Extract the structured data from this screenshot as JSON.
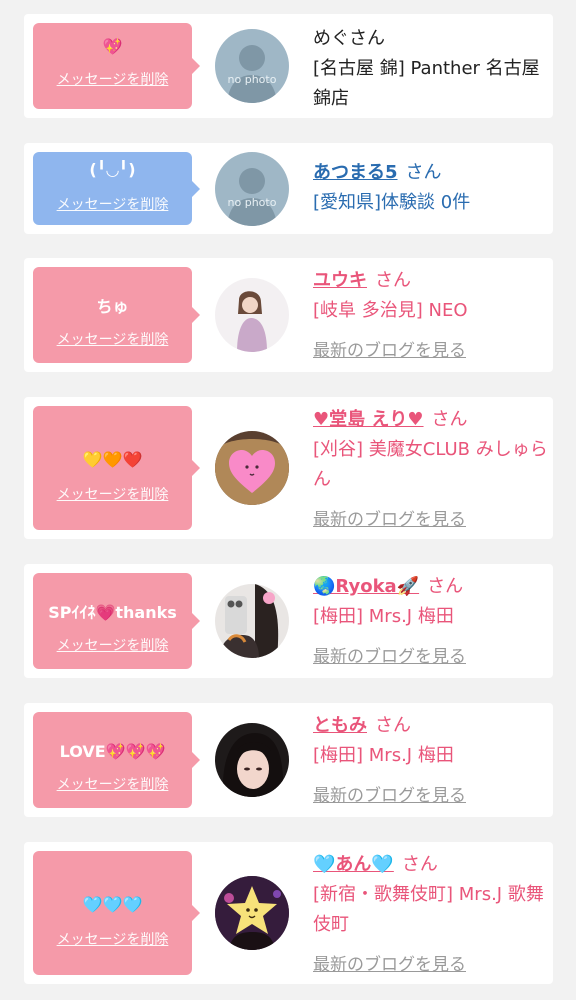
{
  "colors": {
    "pink_accent": "#e9557a",
    "blue_accent": "#2a6cb0",
    "bubble_pink": "#f59aa9",
    "bubble_blue": "#8fb6ee",
    "card_bg": "#ffffff",
    "page_bg": "#f2f2f2",
    "blog_gray": "#9a9a9a"
  },
  "labels": {
    "delete_message": "メッセージを削除",
    "san": "さん",
    "latest_blog": "最新のブログを見る"
  },
  "cards": [
    {
      "bubble_color": "pink",
      "message": "💖",
      "avatar": "no-photo-icon",
      "avatar_text": "no photo",
      "name": "めぐさん",
      "name_style": "plain",
      "shop": "[名古屋 錦] Panther 名古屋錦店",
      "has_blog": false
    },
    {
      "bubble_color": "blue",
      "message": "(╹◡╹)",
      "avatar": "no-photo-icon",
      "avatar_text": "no photo",
      "name": "あつまる5",
      "name_style": "blue",
      "shop": "[愛知県]体験談 0件",
      "has_blog": false
    },
    {
      "bubble_color": "pink",
      "message": "ちゅ",
      "avatar": "girl-photo-icon",
      "name": "ユウキ",
      "name_style": "pink",
      "shop": "[岐阜 多治見] NEO",
      "has_blog": true
    },
    {
      "bubble_color": "pink",
      "message": "💛🧡❤️",
      "avatar": "girl-photo-heart-icon",
      "name": "♥堂島 えり♥",
      "name_style": "pink",
      "shop": "[刈谷] 美魔女CLUB みしゅらん",
      "has_blog": true
    },
    {
      "bubble_color": "pink",
      "message": "SPｲｲﾈ💗thanks",
      "avatar": "girl-photo-phone-icon",
      "name": "🌏Ryoka🚀",
      "name_style": "pink",
      "shop": "[梅田] Mrs.J 梅田",
      "has_blog": true
    },
    {
      "bubble_color": "pink",
      "message": "LOVE💖💖💖",
      "avatar": "girl-photo-face-icon",
      "name": "ともみ",
      "name_style": "pink",
      "shop": "[梅田] Mrs.J 梅田",
      "has_blog": true
    },
    {
      "bubble_color": "pink",
      "message": "🩵🩵🩵",
      "avatar": "girl-photo-star-icon",
      "name": "🩵あん🩵",
      "name_style": "pink",
      "shop": "[新宿・歌舞伎町] Mrs.J 歌舞伎町",
      "has_blog": true
    }
  ]
}
